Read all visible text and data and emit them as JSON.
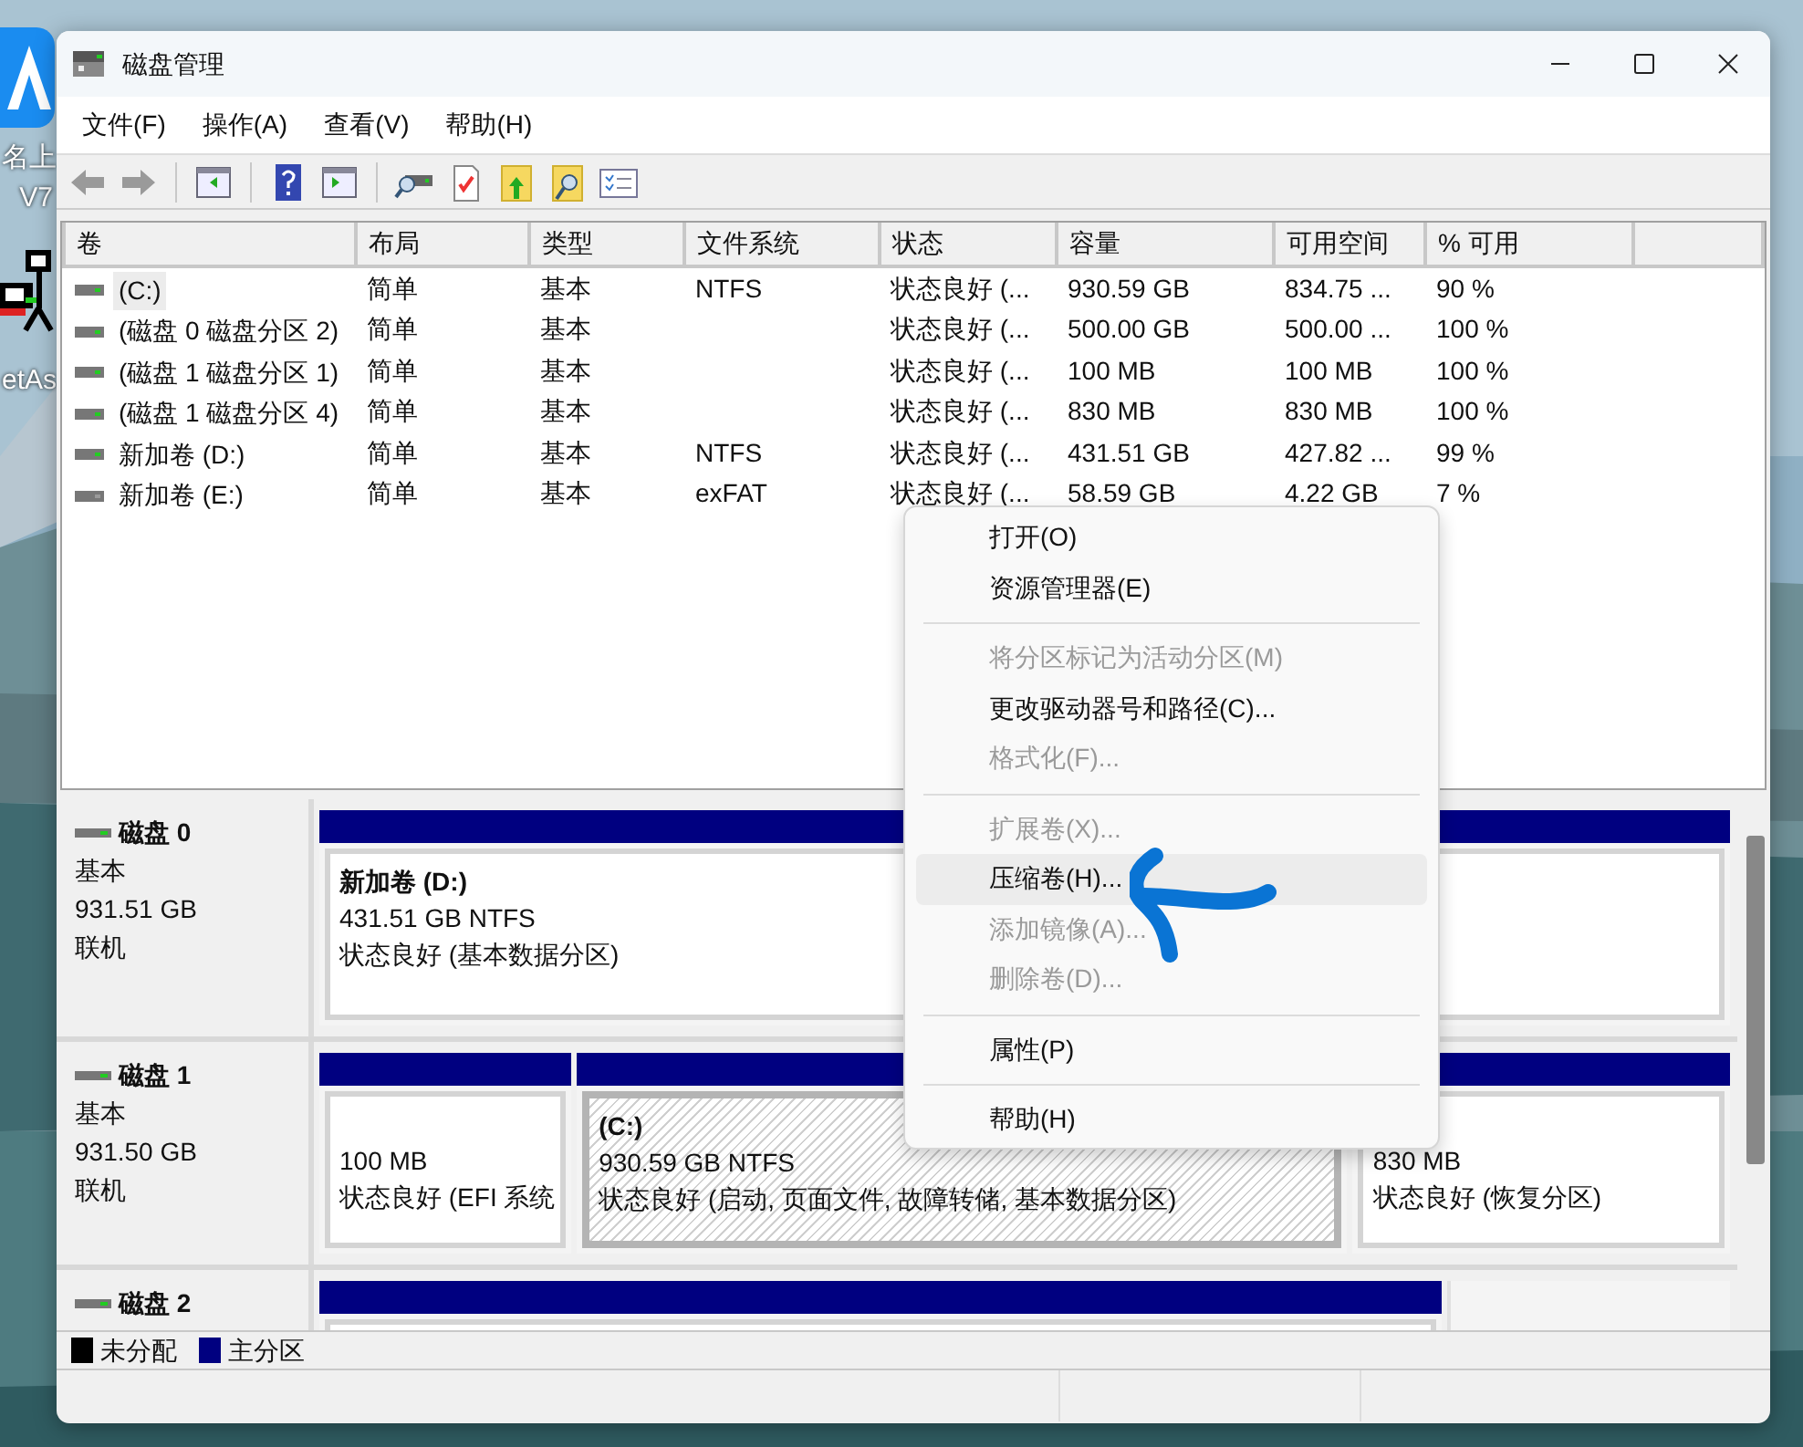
{
  "desktop": {
    "icons": [
      {
        "kind": "app",
        "label_lines": [
          "名上",
          "V7"
        ]
      },
      {
        "kind": "figure",
        "label_lines": [
          "etAs"
        ]
      }
    ]
  },
  "window": {
    "title": "磁盘管理"
  },
  "menu": [
    "文件(F)",
    "操作(A)",
    "查看(V)",
    "帮助(H)"
  ],
  "toolbar": [
    {
      "kind": "back"
    },
    {
      "kind": "forward"
    },
    {
      "kind": "separator"
    },
    {
      "kind": "tree"
    },
    {
      "kind": "separator"
    },
    {
      "kind": "help"
    },
    {
      "kind": "pane"
    },
    {
      "kind": "separator"
    },
    {
      "kind": "connect"
    },
    {
      "kind": "check"
    },
    {
      "kind": "folder-up"
    },
    {
      "kind": "folder-search"
    },
    {
      "kind": "list"
    }
  ],
  "volume_table": {
    "columns": [
      "卷",
      "布局",
      "类型",
      "文件系统",
      "状态",
      "容量",
      "可用空间",
      "% 可用"
    ],
    "rows": [
      {
        "kind": "disk",
        "selected": true,
        "cells": [
          "(C:)",
          "简单",
          "基本",
          "NTFS",
          "状态良好 (...",
          "930.59 GB",
          "834.75 ...",
          "90 %"
        ]
      },
      {
        "kind": "disk",
        "selected": false,
        "cells": [
          "(磁盘 0 磁盘分区 2)",
          "简单",
          "基本",
          "",
          "状态良好 (...",
          "500.00 GB",
          "500.00 ...",
          "100 %"
        ]
      },
      {
        "kind": "disk",
        "selected": false,
        "cells": [
          "(磁盘 1 磁盘分区 1)",
          "简单",
          "基本",
          "",
          "状态良好 (...",
          "100 MB",
          "100 MB",
          "100 %"
        ]
      },
      {
        "kind": "disk",
        "selected": false,
        "cells": [
          "(磁盘 1 磁盘分区 4)",
          "简单",
          "基本",
          "",
          "状态良好 (...",
          "830 MB",
          "830 MB",
          "100 %"
        ]
      },
      {
        "kind": "disk",
        "selected": false,
        "cells": [
          "新加卷 (D:)",
          "简单",
          "基本",
          "NTFS",
          "状态良好 (...",
          "431.51 GB",
          "427.82 ...",
          "99 %"
        ]
      },
      {
        "kind": "removable",
        "selected": false,
        "cells": [
          "新加卷 (E:)",
          "简单",
          "基本",
          "exFAT",
          "状态良好 (...",
          "58.59 GB",
          "4.22 GB",
          "7 %"
        ]
      }
    ]
  },
  "disks": [
    {
      "name": "磁盘 0",
      "lines": [
        "基本",
        "931.51 GB",
        "联机"
      ],
      "partitions": [
        {
          "kind": "primary",
          "selected": false,
          "title": "新加卷  (D:)",
          "lines": [
            "431.51 GB NTFS",
            "状态良好 (基本数据分区)"
          ]
        }
      ]
    },
    {
      "name": "磁盘 1",
      "lines": [
        "基本",
        "931.50 GB",
        "联机"
      ],
      "partitions": [
        {
          "kind": "primary",
          "selected": false,
          "lines": [
            "100 MB",
            "状态良好 (EFI 系统"
          ]
        },
        {
          "kind": "primary",
          "selected": true,
          "title": "(C:)",
          "lines": [
            "930.59 GB NTFS",
            "状态良好 (启动, 页面文件, 故障转储, 基本数据分区)"
          ]
        },
        {
          "kind": "primary",
          "selected": false,
          "lines": [
            "830 MB",
            "状态良好 (恢复分区)"
          ]
        }
      ]
    },
    {
      "name": "磁盘 2",
      "partitions": [
        {
          "kind": "primary",
          "selected": false
        },
        {
          "kind": "blank"
        }
      ]
    }
  ],
  "legend": [
    {
      "label": "未分配",
      "color": "#000000"
    },
    {
      "label": "主分区",
      "color": "#000080"
    }
  ],
  "context_menu": {
    "items": [
      {
        "kind": "item",
        "label": "打开(O)",
        "disabled": false,
        "selected": false
      },
      {
        "kind": "item",
        "label": "资源管理器(E)",
        "disabled": false,
        "selected": false
      },
      {
        "kind": "separator"
      },
      {
        "kind": "item",
        "label": "将分区标记为活动分区(M)",
        "disabled": true,
        "selected": false
      },
      {
        "kind": "item",
        "label": "更改驱动器号和路径(C)...",
        "disabled": false,
        "selected": false
      },
      {
        "kind": "item",
        "label": "格式化(F)...",
        "disabled": true,
        "selected": false
      },
      {
        "kind": "separator"
      },
      {
        "kind": "item",
        "label": "扩展卷(X)...",
        "disabled": true,
        "selected": false
      },
      {
        "kind": "item",
        "label": "压缩卷(H)...",
        "disabled": false,
        "selected": true
      },
      {
        "kind": "item",
        "label": "添加镜像(A)...",
        "disabled": true,
        "selected": false
      },
      {
        "kind": "item",
        "label": "删除卷(D)...",
        "disabled": true,
        "selected": false
      },
      {
        "kind": "separator"
      },
      {
        "kind": "item",
        "label": "属性(P)",
        "disabled": false,
        "selected": false
      },
      {
        "kind": "separator"
      },
      {
        "kind": "item",
        "label": "帮助(H)",
        "disabled": false,
        "selected": false
      }
    ]
  }
}
